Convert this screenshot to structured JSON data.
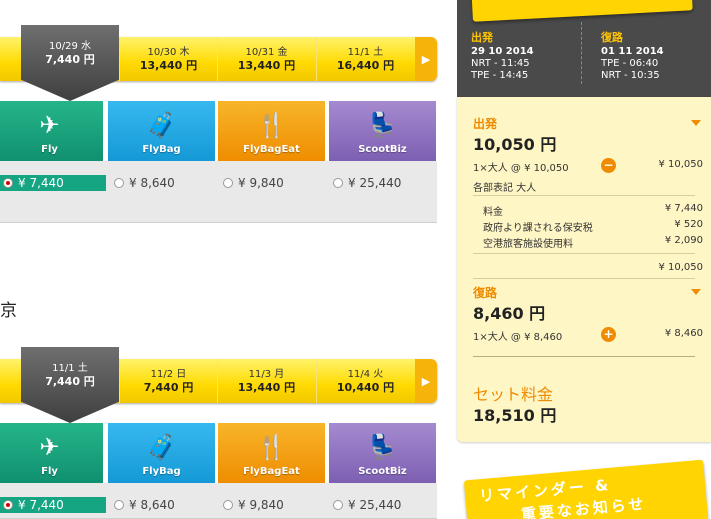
{
  "outbound": {
    "dates": [
      {
        "date": "10/29 水",
        "price": "7,440 円",
        "selected": true
      },
      {
        "date": "10/30 木",
        "price": "13,440 円"
      },
      {
        "date": "10/31 金",
        "price": "13,440 円"
      },
      {
        "date": "11/1 土",
        "price": "16,440 円"
      }
    ],
    "fares": [
      {
        "label": "Fly",
        "price": "¥ 7,440",
        "selected": true
      },
      {
        "label": "FlyBag",
        "price": "¥ 8,640"
      },
      {
        "label": "FlyBagEat",
        "price": "¥ 9,840"
      },
      {
        "label": "ScootBiz",
        "price": "¥ 25,440"
      }
    ]
  },
  "station_text": "京",
  "inbound": {
    "dates": [
      {
        "date": "11/1 土",
        "price": "7,440 円",
        "selected": true
      },
      {
        "date": "11/2 日",
        "price": "7,440 円"
      },
      {
        "date": "11/3 月",
        "price": "13,440 円"
      },
      {
        "date": "11/4 火",
        "price": "10,440 円"
      }
    ],
    "fares": [
      {
        "label": "Fly",
        "price": "¥ 7,440",
        "selected": true
      },
      {
        "label": "FlyBag",
        "price": "¥ 8,640"
      },
      {
        "label": "FlyBagEat",
        "price": "¥ 9,840"
      },
      {
        "label": "ScootBiz",
        "price": "¥ 25,440"
      }
    ]
  },
  "summary": {
    "outbound": {
      "heading": "出発",
      "date": "29 10 2014",
      "dep": "NRT - 11:45",
      "arr": "TPE - 14:45"
    },
    "inbound": {
      "heading": "復路",
      "date": "01 11 2014",
      "dep": "TPE - 06:40",
      "arr": "NRT - 10:35"
    },
    "out_block": {
      "heading": "出発",
      "amount": "10,050 円",
      "pax_line": "1×大人 @ ¥ 10,050",
      "pax_total": "¥ 10,050",
      "breakdown_title": "各部表記 大人",
      "items": [
        {
          "label": "料金",
          "value": "¥ 7,440"
        },
        {
          "label": "政府より課される保安税",
          "value": "¥ 520"
        },
        {
          "label": "空港旅客施設使用料",
          "value": "¥ 2,090"
        }
      ],
      "subtotal": "¥ 10,050",
      "toggle": "−"
    },
    "in_block": {
      "heading": "復路",
      "amount": "8,460 円",
      "pax_line": "1×大人 @ ¥ 8,460",
      "pax_total": "¥ 8,460",
      "toggle": "+"
    },
    "total": {
      "label": "セット料金",
      "amount": "18,510 円"
    }
  },
  "reminder": {
    "line1": "リマインダー &",
    "line2": "重要なお知らせ"
  }
}
